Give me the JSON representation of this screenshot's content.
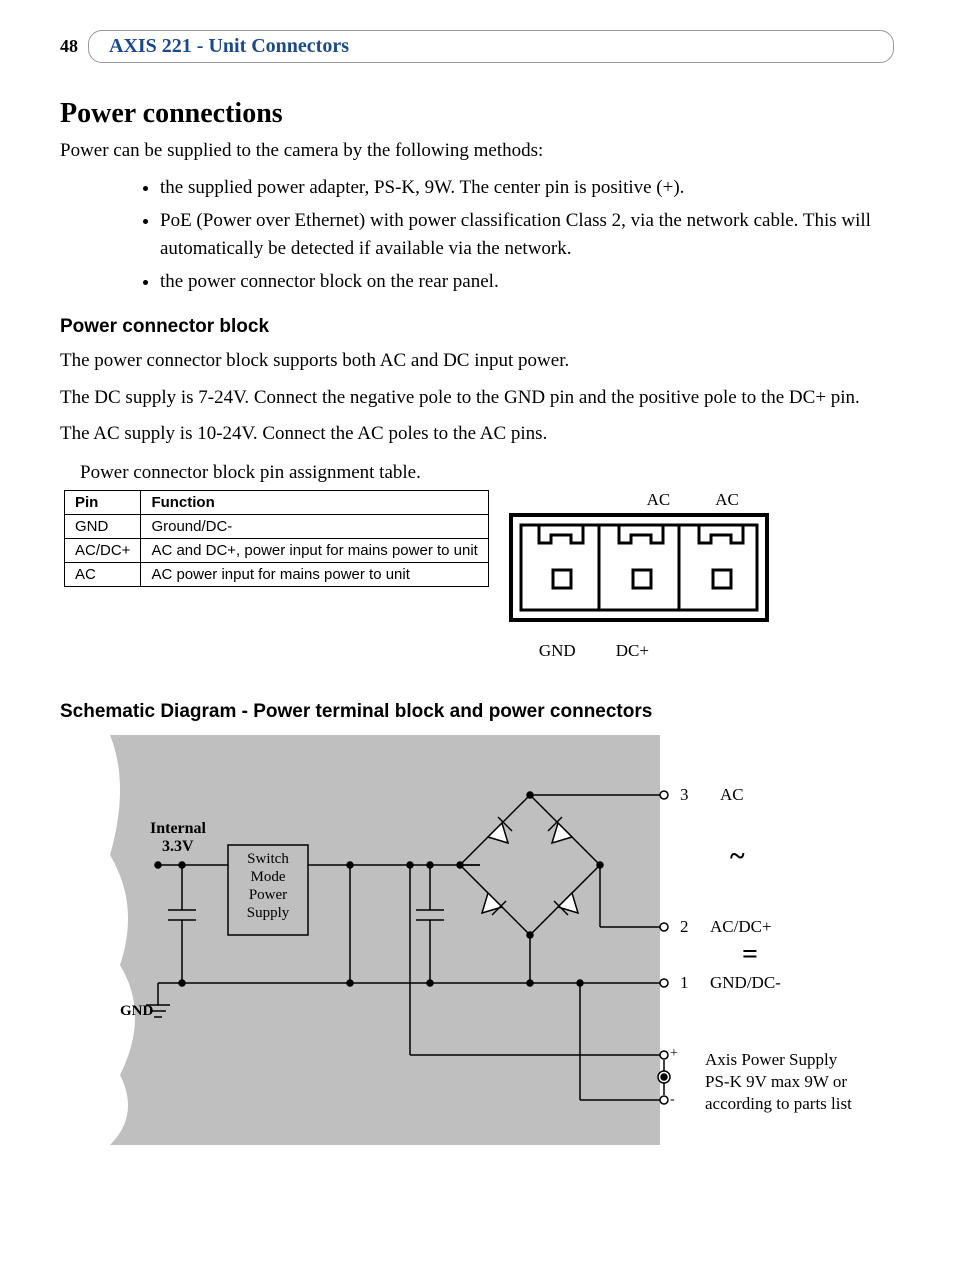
{
  "page_number": "48",
  "header_title": "AXIS 221 - Unit Connectors",
  "h1": "Power connections",
  "intro": "Power can be supplied to the camera by the following methods:",
  "methods": [
    "the supplied power adapter, PS-K, 9W. The center pin is positive (+).",
    "PoE (Power over Ethernet) with power classification Class 2, via the network cable. This will automatically be detected if available via the network.",
    "the power connector block on the rear panel."
  ],
  "h2_block": "Power connector block",
  "block_p1": "The power connector block supports both AC and DC input power.",
  "block_p2": "The DC supply is 7-24V. Connect the negative pole to the GND pin and the positive pole to the DC+ pin.",
  "block_p3": "The AC supply is 10-24V. Connect the AC poles to the AC pins.",
  "table_caption": "Power connector block pin assignment table.",
  "table": {
    "headers": {
      "pin": "Pin",
      "func": "Function"
    },
    "rows": [
      {
        "pin": "GND",
        "func": "Ground/DC-"
      },
      {
        "pin": "AC/DC+",
        "func": "AC and DC+, power input for mains power to unit"
      },
      {
        "pin": "AC",
        "func": "AC power input for mains power to unit"
      }
    ]
  },
  "connector": {
    "top_left": "AC",
    "top_right": "AC",
    "bottom_left": "GND",
    "bottom_right": "DC+"
  },
  "h3_schematic": "Schematic Diagram - Power terminal block and power connectors",
  "schematic": {
    "internal": "Internal",
    "voltage": "3.3V",
    "smps_l1": "Switch",
    "smps_l2": "Mode",
    "smps_l3": "Power",
    "smps_l4": "Supply",
    "gnd": "GND",
    "t3": "3",
    "t3_label": "AC",
    "t2": "2",
    "t2_label": "AC/DC+",
    "t1": "1",
    "t1_label": "GND/DC-",
    "plus": "+",
    "minus": "-",
    "ps_l1": "Axis Power Supply",
    "ps_l2": "PS-K 9V max 9W or",
    "ps_l3": "according to parts list",
    "tilde": "~",
    "equals": "="
  }
}
